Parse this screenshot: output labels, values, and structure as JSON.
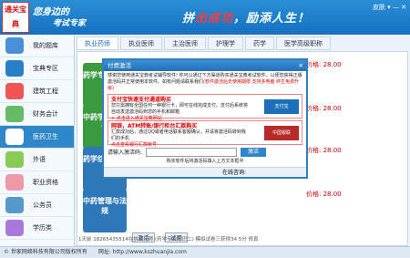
{
  "header": {
    "logo_text": "通关宝典",
    "slogan_1": "您身边的",
    "slogan_2": "考试专家",
    "motto_a": "拼",
    "motto_hl": "出成功",
    "motto_b": "，励添人生！",
    "controls": "皮肤 ▾  —  ✕"
  },
  "sidebar": {
    "items": [
      {
        "label": "我的题库"
      },
      {
        "label": "宝典专区"
      },
      {
        "label": "建筑工程"
      },
      {
        "label": "财务会计"
      },
      {
        "label": "医药卫生"
      },
      {
        "label": "外语"
      },
      {
        "label": "职业资格"
      },
      {
        "label": "公务员"
      },
      {
        "label": "学历类"
      }
    ]
  },
  "tabs": [
    "执业药师",
    "执业医师",
    "主治医师",
    "护理学",
    "药学",
    "医学高级职称"
  ],
  "cards": [
    {
      "label": "药学专业知识"
    },
    {
      "label": "中药学专业知识"
    },
    {
      "label": "药学综合知识"
    },
    {
      "label": "中药管理与法规"
    }
  ],
  "prices": [
    "价格: 28.00",
    "价格: 28.00",
    "价格: 28.00",
    "价格: 28.00"
  ],
  "buttons": {
    "activate_small": "激活",
    "trial": "试用"
  },
  "dialog": {
    "title": "付费激活",
    "close": "✕",
    "intro": "感谢您使用通关宝典考试辅导软件! 你可以通过下方渠道购买通关宝典考试软件，以便您获得正版激活码并正常使用本软件。如有问题请联系我们",
    "intro_red": "(软件激活后无使用期限 支持多电脑 终生免费升级)",
    "box1_title": "支付宝快速支付通道购买",
    "box1_text": "您只需拥有全国任何一种银行卡，即可在线完成支付。支付后系统将自动发送激活码到您的手机和邮箱",
    "box1_link": "> 点击进入通关宝典网站",
    "box1_logo": "支付宝",
    "box2_title": "网银，ATM转账/银行柜台汇款购买",
    "box2_text": "汇款成功后，通过QQ或者电话联系客服确认，并请将激活码转到我们的手机",
    "box2_link": "点击查看银行汇款帐号",
    "box2_logo": "中国银联",
    "code_label": "请输入激活码:",
    "code_value": "",
    "activate": "激活",
    "footer_text": "购买软件后将激活码填入上方文本框中",
    "online": "在线咨询:"
  },
  "status": {
    "text": "© 世家网络科技有限公司版权所有",
    "url": "网址: http://www.kszhuanjia.com",
    "notice": "1天前 18265435514在执业药师 (药学专业知识二) 模拟试卷三获得34.5分 修真"
  }
}
